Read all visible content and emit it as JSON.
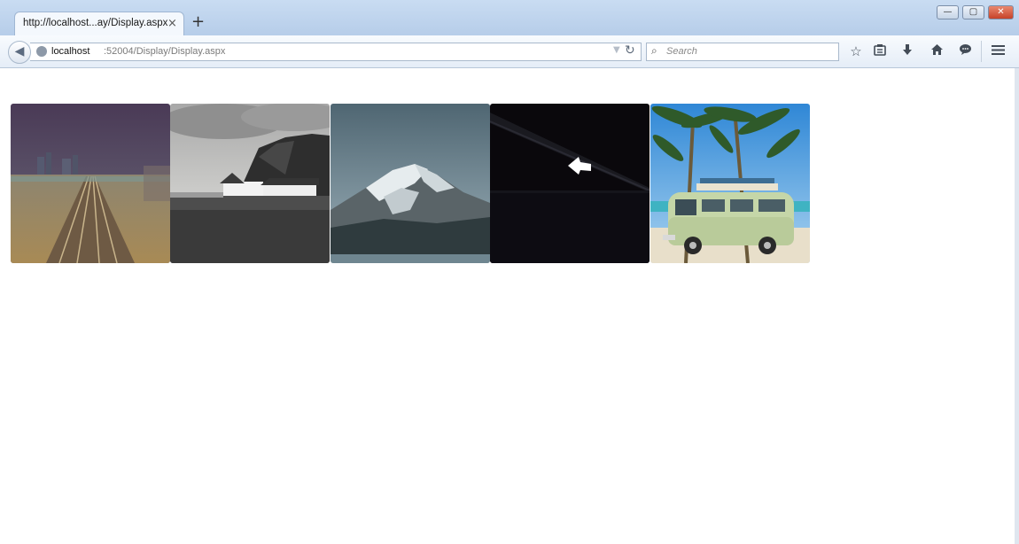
{
  "browser": {
    "tab_title": "http://localhost...ay/Display.aspx",
    "tab_close": "×",
    "new_tab": "+",
    "url_host": "localhost",
    "url_rest": ":52004/Display/Display.aspx",
    "search_placeholder": "Search",
    "window_controls": {
      "minimize": "—",
      "maximize": "▢",
      "close": "✕"
    }
  },
  "toolbar_icons": [
    "bookmark-star-icon",
    "reading-list-icon",
    "download-icon",
    "home-icon",
    "chat-icon",
    "menu-icon"
  ],
  "gallery": {
    "images": [
      {
        "name": "railway-tracks-city-dusk"
      },
      {
        "name": "white-cottages-under-cliff"
      },
      {
        "name": "snowy-mountain-lake"
      },
      {
        "name": "dark-bridge-night-with-cursor"
      },
      {
        "name": "green-van-under-palm-trees"
      }
    ]
  },
  "colors": {
    "titlebar": "#c9dcf2",
    "toolbar": "#eef3f9",
    "page_bg": "#ffffff"
  }
}
